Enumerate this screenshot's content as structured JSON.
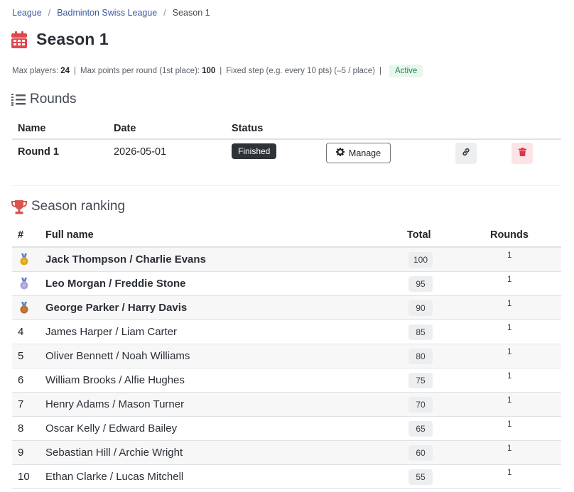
{
  "breadcrumb": {
    "items": [
      "League",
      "Badminton Swiss League"
    ],
    "current": "Season 1"
  },
  "page": {
    "title": "Season 1",
    "icon": "calendar-icon"
  },
  "meta": {
    "max_players_label": "Max players:",
    "max_players": "24",
    "max_points_label": "Max points per round (1st place):",
    "max_points": "100",
    "step_text": "Fixed step (e.g. every 10 pts) (–5 / place)",
    "status": "Active",
    "separator": "|"
  },
  "rounds_section": {
    "title": "Rounds",
    "icon": "list-ordered-icon",
    "headers": {
      "name": "Name",
      "date": "Date",
      "status": "Status"
    },
    "rows": [
      {
        "name": "Round 1",
        "date": "2026-05-01",
        "status": "Finished",
        "manage_label": "Manage"
      }
    ]
  },
  "ranking_section": {
    "title": "Season ranking",
    "icon": "trophy-icon",
    "headers": {
      "rank": "#",
      "name": "Full name",
      "total": "Total",
      "rounds": "Rounds"
    },
    "rows": [
      {
        "rank": "1",
        "medal": "gold-medal-icon",
        "name": "Jack Thompson / Charlie Evans",
        "total": "100",
        "rounds": "1"
      },
      {
        "rank": "2",
        "medal": "silver-medal-icon",
        "name": "Leo Morgan / Freddie Stone",
        "total": "95",
        "rounds": "1"
      },
      {
        "rank": "3",
        "medal": "bronze-medal-icon",
        "name": "George Parker / Harry Davis",
        "total": "90",
        "rounds": "1"
      },
      {
        "rank": "4",
        "name": "James Harper / Liam Carter",
        "total": "85",
        "rounds": "1"
      },
      {
        "rank": "5",
        "name": "Oliver Bennett / Noah Williams",
        "total": "80",
        "rounds": "1"
      },
      {
        "rank": "6",
        "name": "William Brooks / Alfie Hughes",
        "total": "75",
        "rounds": "1"
      },
      {
        "rank": "7",
        "name": "Henry Adams / Mason Turner",
        "total": "70",
        "rounds": "1"
      },
      {
        "rank": "8",
        "name": "Oscar Kelly / Edward Bailey",
        "total": "65",
        "rounds": "1"
      },
      {
        "rank": "9",
        "name": "Sebastian Hill / Archie Wright",
        "total": "60",
        "rounds": "1"
      },
      {
        "rank": "10",
        "name": "Ethan Clarke / Lucas Mitchell",
        "total": "55",
        "rounds": "1"
      }
    ]
  },
  "colors": {
    "link": "#3d5a9e",
    "calendar": "#e0474c",
    "trophy": "#d9534f",
    "active_bg": "#e8f6ed",
    "active_text": "#1f8a4c",
    "finished_bg": "#2f3337",
    "delete": "#dc3545",
    "gold": "#f0b429",
    "silver": "#b8b4e6",
    "bronze": "#c67a3c"
  }
}
